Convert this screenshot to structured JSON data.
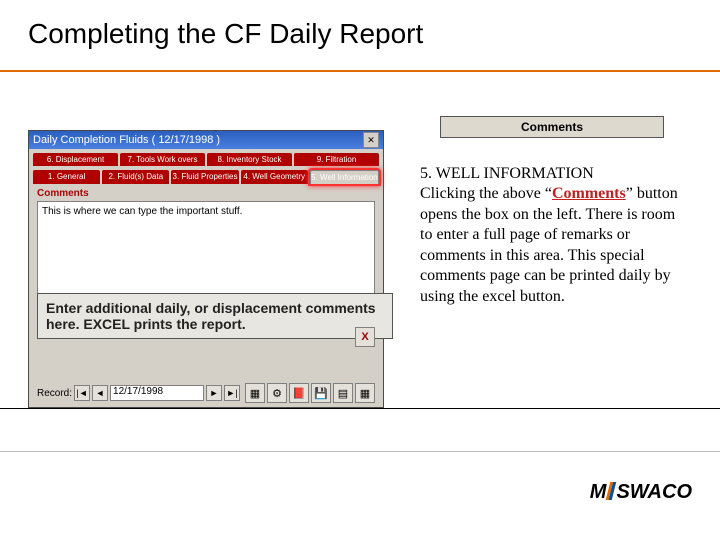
{
  "title": "Completing the CF Daily Report",
  "comments_btn": "Comments",
  "app": {
    "window_title": "Daily Completion Fluids ( 12/17/1998 )",
    "tb_close": "✕",
    "pages": {
      "r1": [
        "6. Displacement",
        "7. Tools Work overs",
        "8. Inventory Stock",
        "9. Filtration"
      ],
      "r2": [
        "1. General",
        "2. Fluid(s) Data",
        "3. Fluid Properties",
        "4. Well Geometry",
        "5. Well Information"
      ]
    },
    "section_label": "Comments",
    "textarea_value": "This is where we can type the important stuff.",
    "callout": "Enter additional daily, or displacement comments here.  EXCEL prints the report.",
    "small_icon_a": "X",
    "record_date": "12/17/1998",
    "nav": {
      "first": "|◄",
      "prev": "◄",
      "next": "►",
      "last": "►|"
    },
    "toolbar_icons": [
      "grid-icon",
      "gear-icon",
      "book-icon",
      "save-icon",
      "sheet-icon",
      "table-icon"
    ],
    "toolbar_glyphs": [
      "▦",
      "⚙",
      "📕",
      "💾",
      "▤",
      "▦"
    ]
  },
  "body": {
    "line1": "5.  WELL INFORMATION",
    "line2a": "Clicking the above “",
    "line2b": "Comments",
    "line2c": "” button opens the box on the left.  There is room to enter a full page of remarks or comments in this area.  This special comments page can be printed daily by using the excel button."
  },
  "logo": {
    "left": "M",
    "slash": "",
    "right": "SWACO"
  }
}
